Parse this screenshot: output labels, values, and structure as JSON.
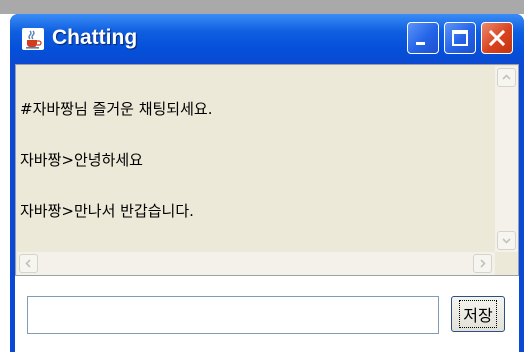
{
  "window": {
    "title": "Chatting",
    "title_icon": "java-cup-icon",
    "caption_buttons": [
      "minimize-icon",
      "maximize-icon",
      "close-icon"
    ]
  },
  "chat": {
    "lines": [
      "#자바짱님 즐거운 채팅되세요.",
      "자바짱>안녕하세요",
      "자바짱>만나서 반갑습니다."
    ]
  },
  "input": {
    "value": "",
    "placeholder": ""
  },
  "buttons": {
    "save_label": "저장"
  },
  "colors": {
    "titlebar": "#0550da",
    "client_background": "#ece9d8",
    "close_button": "#d8431e"
  }
}
